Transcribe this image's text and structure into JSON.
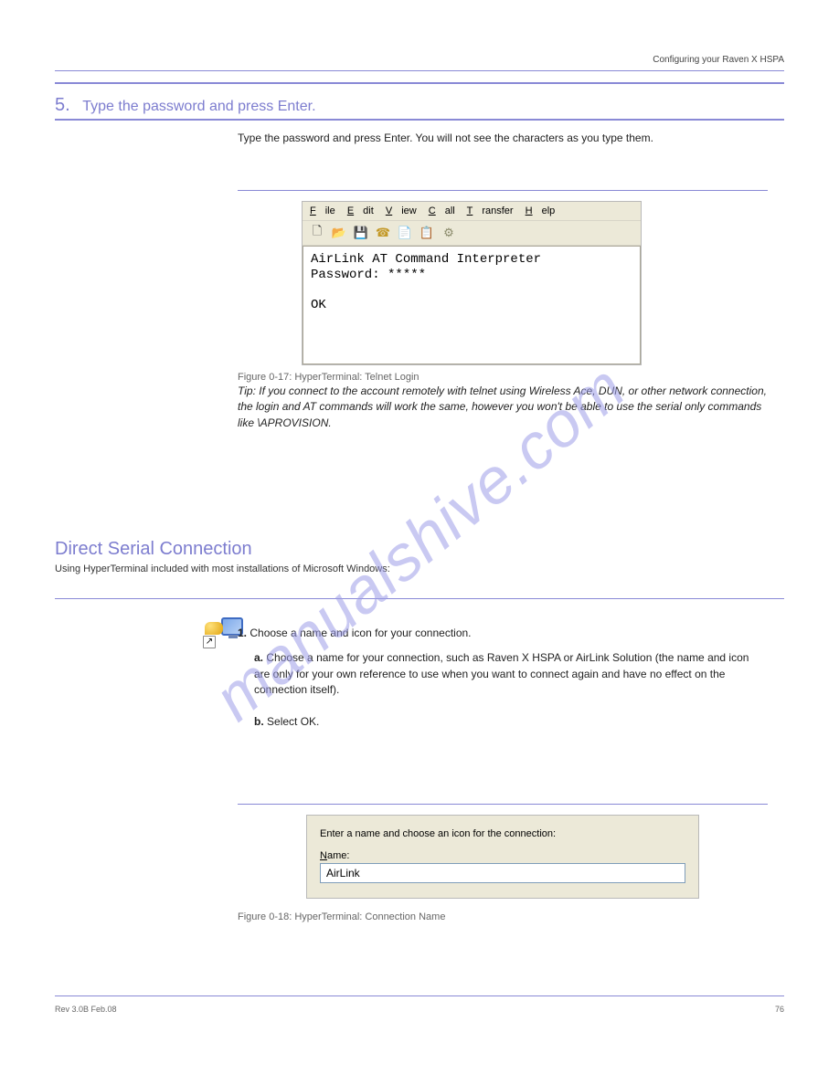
{
  "header": {
    "titleRight": "Configuring your Raven X HSPA"
  },
  "watermark": "manualshive.com",
  "section": {
    "stepTitle": "5.",
    "stepText": "Type the password and press Enter."
  },
  "body": {
    "instr1": "Type the password and press Enter. You will not see the characters as you type them.",
    "tip": "Tip: If you connect to the account remotely with telnet using Wireless Ace, DUN, or other network connection, the login and AT commands will work the same, however you won't be able to use the serial only commands like \\APROVISION.",
    "subhead": "Direct Serial Connection",
    "subheadNote": "Using HyperTerminal included with most installations of Microsoft Windows:",
    "step1": "Choose a name and icon for your connection.",
    "step1a": "Choose a name for your connection, such as Raven X HSPA or AirLink Solution (the name and icon are only for your own reference to use when you want to connect again and have no effect on the connection itself).",
    "step1b": "Select OK."
  },
  "figure1": {
    "menus": [
      "File",
      "Edit",
      "View",
      "Call",
      "Transfer",
      "Help"
    ],
    "term_line1": "AirLink AT Command Interpreter",
    "term_line2": "Password: *****",
    "term_line3": "OK",
    "caption": "Figure 0-17: HyperTerminal: Telnet Login"
  },
  "figure2": {
    "prompt": "Enter a name and choose an icon for the connection:",
    "nameLabel": "Name:",
    "nameValue": "AirLink",
    "caption": "Figure 0-18: HyperTerminal: Connection Name"
  },
  "footer": {
    "rev": "Rev 3.0B Feb.08",
    "page": "76"
  }
}
